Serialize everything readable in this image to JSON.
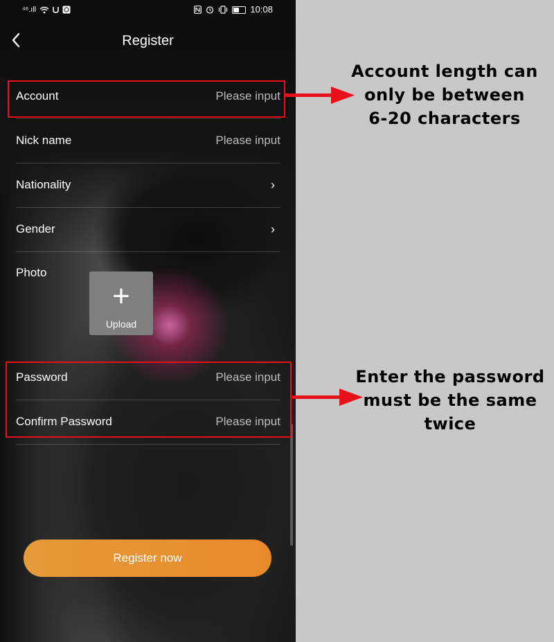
{
  "statusbar": {
    "left_signal": "⁴⁶.ıll",
    "time": "10:08"
  },
  "header": {
    "title": "Register",
    "back_icon": "chevron-left-icon"
  },
  "form": {
    "account": {
      "label": "Account",
      "placeholder": "Please input"
    },
    "nickname": {
      "label": "Nick name",
      "placeholder": "Please input"
    },
    "nationality": {
      "label": "Nationality",
      "chevron": "›"
    },
    "gender": {
      "label": "Gender",
      "chevron": "›"
    },
    "photo": {
      "label": "Photo",
      "upload_label": "Upload",
      "plus": "+"
    },
    "password": {
      "label": "Password",
      "placeholder": "Please input"
    },
    "confirm_password": {
      "label": "Confirm Password",
      "placeholder": "Please input"
    }
  },
  "register_button": {
    "label": "Register now"
  },
  "annotations": {
    "account_note": [
      "Account length can",
      "only be between",
      "6-20 characters"
    ],
    "password_note": [
      "Enter the password",
      "must be the same",
      "twice"
    ],
    "highlight_color": "#e8101a"
  },
  "colors": {
    "button_gradient_start": "#e69a3a",
    "button_gradient_end": "#e8892c",
    "panel_bg": "#c8c8c8"
  }
}
